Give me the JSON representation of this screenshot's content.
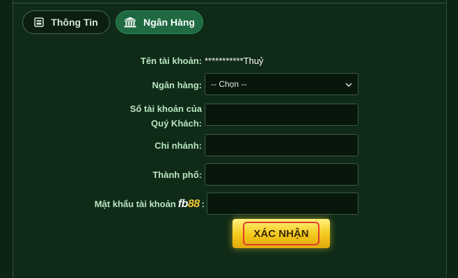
{
  "tabs": [
    {
      "label": "Thông Tin",
      "icon": "profile-card-icon"
    },
    {
      "label": "Ngân Hàng",
      "icon": "bank-icon"
    }
  ],
  "form": {
    "account_name_label": "Tên tài khoản:",
    "account_name_value": "***********Thuỷ",
    "bank_label": "Ngân hàng:",
    "bank_selected": "-- Chọn --",
    "account_number_label_line1": "Số tài khoản của",
    "account_number_label_line2": "Quý Khách:",
    "account_number_value": "",
    "branch_label": "Chi nhánh:",
    "branch_value": "",
    "city_label": "Thành phố:",
    "city_value": "",
    "password_label_prefix": "Mật khẩu tài khoản",
    "password_brand_text": "fb",
    "password_brand_number": "88",
    "password_label_suffix": ":",
    "password_value": "",
    "submit_label": "XÁC NHẬN"
  },
  "colors": {
    "background": "#0d2414",
    "tab_active": "#1f6a41",
    "label_text": "#b9e4bf",
    "button_gold": "#f3c81b",
    "highlight_red": "#e23b2e"
  }
}
